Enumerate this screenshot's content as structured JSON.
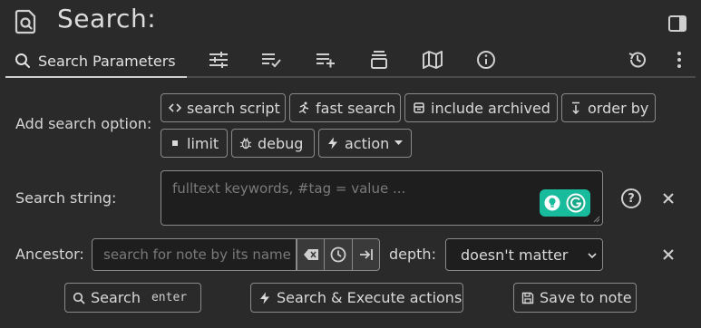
{
  "title": "Search:",
  "ribbon": {
    "active_tab": "Search Parameters",
    "icons": [
      "sliders-icon",
      "list-check-icon",
      "list-add-icon",
      "stack-icon",
      "map-icon",
      "info-icon",
      "history-icon",
      "more-vertical-icon"
    ]
  },
  "options": {
    "label": "Add search option:",
    "buttons": [
      {
        "label": "search script",
        "icon": "code-icon"
      },
      {
        "label": "fast search",
        "icon": "run-icon"
      },
      {
        "label": "include archived",
        "icon": "archive-icon"
      },
      {
        "label": "order by",
        "icon": "sort-icon"
      },
      {
        "label": "limit",
        "icon": "square-icon"
      },
      {
        "label": "debug",
        "icon": "bug-icon"
      },
      {
        "label": "action",
        "icon": "bolt-icon"
      }
    ]
  },
  "search_string": {
    "label": "Search string:",
    "placeholder": "fulltext keywords, #tag = value ..."
  },
  "ancestor": {
    "label": "Ancestor:",
    "placeholder": "search for note by its name",
    "depth_label": "depth:",
    "depth_value": "doesn't matter"
  },
  "actions": {
    "search_label": "Search",
    "search_shortcut": "enter",
    "execute_label": "Search & Execute actions",
    "save_label": "Save to note"
  },
  "colors": {
    "background": "#2a2a2a",
    "border": "#8a8a8a",
    "grammarly": "#18bc9c"
  }
}
